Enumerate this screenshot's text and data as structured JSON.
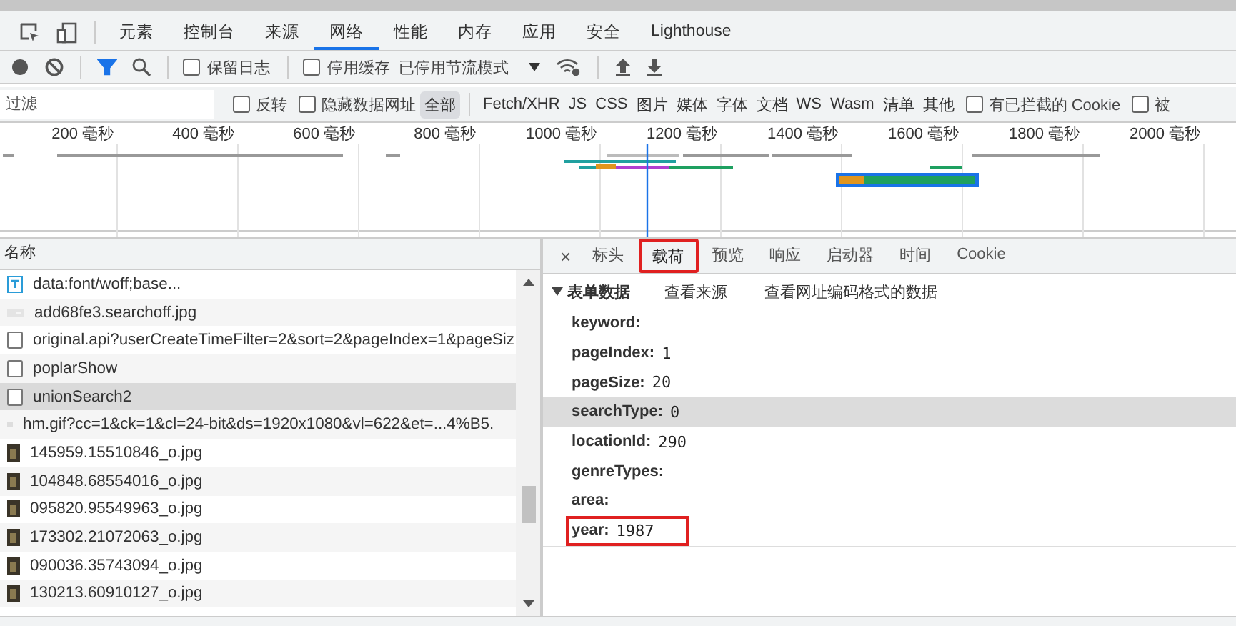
{
  "main_tabs": [
    {
      "label": "元素",
      "selected": false
    },
    {
      "label": "控制台",
      "selected": false
    },
    {
      "label": "来源",
      "selected": false
    },
    {
      "label": "网络",
      "selected": true
    },
    {
      "label": "性能",
      "selected": false
    },
    {
      "label": "内存",
      "selected": false
    },
    {
      "label": "应用",
      "selected": false
    },
    {
      "label": "安全",
      "selected": false
    },
    {
      "label": "Lighthouse",
      "selected": false
    }
  ],
  "toolbar": {
    "filter_active": true,
    "preserve_log": {
      "label": "保留日志",
      "checked": false
    },
    "disable_cache": {
      "label": "停用缓存",
      "checked": false
    },
    "throttling": "已停用节流模式"
  },
  "filter_bar": {
    "placeholder": "过滤",
    "invert": {
      "label": "反转",
      "checked": false
    },
    "hide_data_urls": {
      "label": "隐藏数据网址",
      "checked": false
    },
    "types": [
      {
        "label": "全部",
        "selected": true
      },
      {
        "label": "Fetch/XHR",
        "selected": false
      },
      {
        "label": "JS",
        "selected": false
      },
      {
        "label": "CSS",
        "selected": false
      },
      {
        "label": "图片",
        "selected": false
      },
      {
        "label": "媒体",
        "selected": false
      },
      {
        "label": "字体",
        "selected": false
      },
      {
        "label": "文档",
        "selected": false
      },
      {
        "label": "WS",
        "selected": false
      },
      {
        "label": "Wasm",
        "selected": false
      },
      {
        "label": "清单",
        "selected": false
      },
      {
        "label": "其他",
        "selected": false
      }
    ],
    "blocked_cookies": {
      "label": "有已拦截的 Cookie",
      "checked": false
    },
    "cut_option": {
      "label": "被",
      "checked": false
    }
  },
  "overview": {
    "ticks": [
      "200 毫秒",
      "400 毫秒",
      "600 毫秒",
      "800 毫秒",
      "1000 毫秒",
      "1200 毫秒",
      "1400 毫秒",
      "1600 毫秒",
      "1800 毫秒",
      "2000 毫秒"
    ]
  },
  "requests": {
    "column": "名称",
    "rows": [
      {
        "kind": "font",
        "name": "data:font/woff;base...",
        "selected": false
      },
      {
        "kind": "placeholder",
        "name": "add68fe3.searchoff.jpg",
        "selected": false
      },
      {
        "kind": "document",
        "name": "original.api?userCreateTimeFilter=2&sort=2&pageIndex=1&pageSiz",
        "selected": false
      },
      {
        "kind": "document",
        "name": "poplarShow",
        "selected": false
      },
      {
        "kind": "document",
        "name": "unionSearch2",
        "selected": true
      },
      {
        "kind": "pixel",
        "name": "hm.gif?cc=1&ck=1&cl=24-bit&ds=1920x1080&vl=622&et=...4%B5.",
        "selected": false
      },
      {
        "kind": "thumbnail",
        "name": "145959.15510846_o.jpg",
        "selected": false
      },
      {
        "kind": "thumbnail",
        "name": "104848.68554016_o.jpg",
        "selected": false
      },
      {
        "kind": "thumbnail",
        "name": "095820.95549963_o.jpg",
        "selected": false
      },
      {
        "kind": "thumbnail",
        "name": "173302.21072063_o.jpg",
        "selected": false
      },
      {
        "kind": "thumbnail",
        "name": "090036.35743094_o.jpg",
        "selected": false
      },
      {
        "kind": "thumbnail",
        "name": "130213.60910127_o.jpg",
        "selected": false
      }
    ]
  },
  "detail": {
    "close": "×",
    "tabs": [
      {
        "label": "标头",
        "selected": false,
        "annotated": false
      },
      {
        "label": "载荷",
        "selected": true,
        "annotated": true
      },
      {
        "label": "预览",
        "selected": false,
        "annotated": false
      },
      {
        "label": "响应",
        "selected": false,
        "annotated": false
      },
      {
        "label": "启动器",
        "selected": false,
        "annotated": false
      },
      {
        "label": "时间",
        "selected": false,
        "annotated": false
      },
      {
        "label": "Cookie",
        "selected": false,
        "annotated": false
      }
    ],
    "section": {
      "title": "表单数据",
      "expanded": true,
      "links": [
        "查看来源",
        "查看网址编码格式的数据"
      ]
    },
    "params": [
      {
        "name": "keyword:",
        "selected": false,
        "annotated": false
      },
      {
        "name": "pageIndex:",
        "value": "1",
        "selected": false,
        "annotated": false
      },
      {
        "name": "pageSize:",
        "value": "20",
        "selected": false,
        "annotated": false
      },
      {
        "name": "searchType:",
        "value": "0",
        "selected": true,
        "annotated": false
      },
      {
        "name": "locationId:",
        "value": "290",
        "selected": false,
        "annotated": false
      },
      {
        "name": "genreTypes:",
        "selected": false,
        "annotated": false
      },
      {
        "name": "area:",
        "selected": false,
        "annotated": false
      },
      {
        "name": "year:",
        "value": "1987",
        "selected": false,
        "annotated": true
      }
    ]
  }
}
